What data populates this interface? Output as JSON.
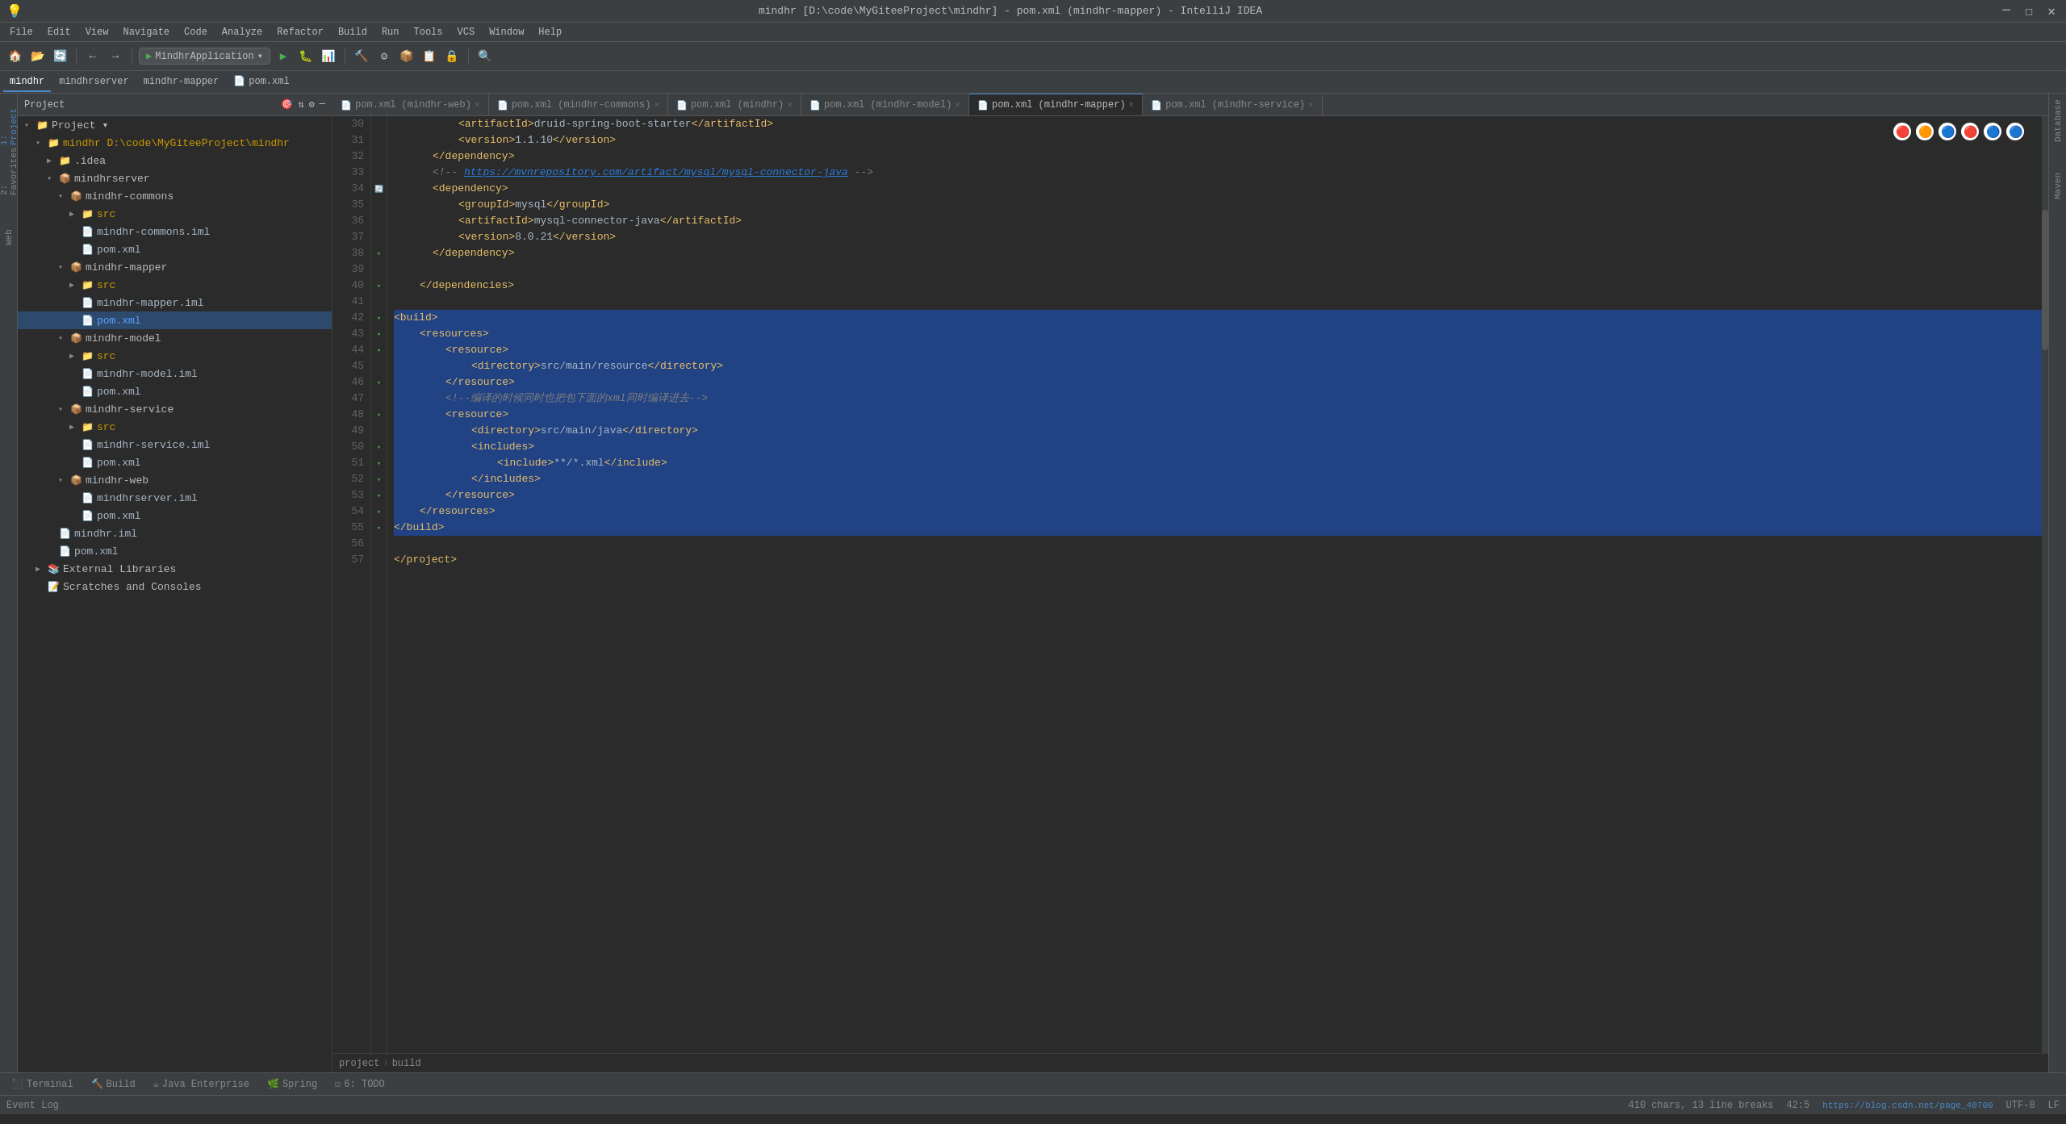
{
  "titleBar": {
    "title": "mindhr [D:\\code\\MyGiteeProject\\mindhr] - pom.xml (mindhr-mapper) - IntelliJ IDEA",
    "minimize": "─",
    "maximize": "☐",
    "close": "✕"
  },
  "menuBar": {
    "items": [
      "File",
      "Edit",
      "View",
      "Navigate",
      "Code",
      "Analyze",
      "Refactor",
      "Build",
      "Run",
      "Tools",
      "VCS",
      "Window",
      "Help"
    ]
  },
  "toolbar": {
    "runConfig": "MindhrApplication",
    "buttons": [
      "⬛",
      "📂",
      "🔄",
      "←",
      "→",
      "↩",
      "🔍",
      "▶",
      "🐛",
      "📊",
      "🔨",
      "🔧",
      "📦",
      "📋",
      "🔒",
      "⚙",
      "🔍"
    ]
  },
  "projectTabs": {
    "items": [
      "mindhr",
      "mindhrserver",
      "mindhr-mapper",
      "pom.xml"
    ]
  },
  "fileTree": {
    "header": "Project",
    "items": [
      {
        "id": "project-root",
        "label": "Project",
        "indent": 0,
        "type": "root",
        "expanded": true
      },
      {
        "id": "mindhr-root",
        "label": "mindhr D:\\code\\MyGiteeProject\\mindhr",
        "indent": 1,
        "type": "folder",
        "expanded": true
      },
      {
        "id": "idea",
        "label": ".idea",
        "indent": 2,
        "type": "folder",
        "expanded": false
      },
      {
        "id": "mindhrserver",
        "label": "mindhrserver",
        "indent": 2,
        "type": "module",
        "expanded": true
      },
      {
        "id": "mindhr-commons",
        "label": "mindhr-commons",
        "indent": 3,
        "type": "module",
        "expanded": true
      },
      {
        "id": "commons-src",
        "label": "src",
        "indent": 4,
        "type": "folder",
        "expanded": false
      },
      {
        "id": "commons-iml",
        "label": "mindhr-commons.iml",
        "indent": 4,
        "type": "iml"
      },
      {
        "id": "commons-pom",
        "label": "pom.xml",
        "indent": 4,
        "type": "xml"
      },
      {
        "id": "mindhr-mapper",
        "label": "mindhr-mapper",
        "indent": 3,
        "type": "module",
        "expanded": true
      },
      {
        "id": "mapper-src",
        "label": "src",
        "indent": 4,
        "type": "folder",
        "expanded": false
      },
      {
        "id": "mapper-iml",
        "label": "mindhr-mapper.iml",
        "indent": 4,
        "type": "iml"
      },
      {
        "id": "mapper-pom",
        "label": "pom.xml",
        "indent": 4,
        "type": "xml",
        "selected": true
      },
      {
        "id": "mindhr-model",
        "label": "mindhr-model",
        "indent": 3,
        "type": "module",
        "expanded": true
      },
      {
        "id": "model-src",
        "label": "src",
        "indent": 4,
        "type": "folder",
        "expanded": false
      },
      {
        "id": "model-iml",
        "label": "mindhr-model.iml",
        "indent": 4,
        "type": "iml"
      },
      {
        "id": "model-pom",
        "label": "pom.xml",
        "indent": 4,
        "type": "xml"
      },
      {
        "id": "mindhr-service",
        "label": "mindhr-service",
        "indent": 3,
        "type": "module",
        "expanded": true
      },
      {
        "id": "service-src",
        "label": "src",
        "indent": 4,
        "type": "folder",
        "expanded": false
      },
      {
        "id": "service-iml",
        "label": "mindhr-service.iml",
        "indent": 4,
        "type": "iml"
      },
      {
        "id": "service-pom",
        "label": "pom.xml",
        "indent": 4,
        "type": "xml"
      },
      {
        "id": "mindhr-web",
        "label": "mindhr-web",
        "indent": 3,
        "type": "module",
        "expanded": true
      },
      {
        "id": "web-iml",
        "label": "mindhrserver.iml",
        "indent": 4,
        "type": "iml"
      },
      {
        "id": "web-pom",
        "label": "pom.xml",
        "indent": 4,
        "type": "xml"
      },
      {
        "id": "mindhr-iml",
        "label": "mindhr.iml",
        "indent": 2,
        "type": "iml"
      },
      {
        "id": "root-pom",
        "label": "pom.xml",
        "indent": 2,
        "type": "xml"
      },
      {
        "id": "ext-libs",
        "label": "External Libraries",
        "indent": 1,
        "type": "extlib",
        "expanded": false
      },
      {
        "id": "scratches",
        "label": "Scratches and Consoles",
        "indent": 1,
        "type": "scratches"
      }
    ]
  },
  "editorTabs": [
    {
      "label": "pom.xml (mindhr-web)",
      "active": false,
      "closeable": true
    },
    {
      "label": "pom.xml (mindhr-commons)",
      "active": false,
      "closeable": true
    },
    {
      "label": "pom.xml (mindhr)",
      "active": false,
      "closeable": true
    },
    {
      "label": "pom.xml (mindhr-model)",
      "active": false,
      "closeable": true
    },
    {
      "label": "pom.xml (mindhr-mapper)",
      "active": true,
      "closeable": true
    },
    {
      "label": "pom.xml (mindhr-service)",
      "active": false,
      "closeable": true
    }
  ],
  "codeLines": [
    {
      "num": 30,
      "content": "        <artifactId>druid-spring-boot-starter</artifactId>",
      "selected": false
    },
    {
      "num": 31,
      "content": "        <version>1.1.10</version>",
      "selected": false
    },
    {
      "num": 32,
      "content": "    </dependency>",
      "selected": false
    },
    {
      "num": 33,
      "content": "    <!-- https://mvnrepository.com/artifact/mysql/mysql-connector-java -->",
      "selected": false
    },
    {
      "num": 34,
      "content": "    <dependency>",
      "selected": false
    },
    {
      "num": 35,
      "content": "        <groupId>mysql</groupId>",
      "selected": false
    },
    {
      "num": 36,
      "content": "        <artifactId>mysql-connector-java</artifactId>",
      "selected": false
    },
    {
      "num": 37,
      "content": "        <version>8.0.21</version>",
      "selected": false
    },
    {
      "num": 38,
      "content": "    </dependency>",
      "selected": false
    },
    {
      "num": 39,
      "content": "",
      "selected": false
    },
    {
      "num": 40,
      "content": "</dependencies>",
      "selected": false
    },
    {
      "num": 41,
      "content": "",
      "selected": false
    },
    {
      "num": 42,
      "content": "<build>",
      "selected": true,
      "cursorLine": true
    },
    {
      "num": 43,
      "content": "    <resources>",
      "selected": true
    },
    {
      "num": 44,
      "content": "        <resource>",
      "selected": true
    },
    {
      "num": 45,
      "content": "            <directory>src/main/resource</directory>",
      "selected": true
    },
    {
      "num": 46,
      "content": "        </resource>",
      "selected": true
    },
    {
      "num": 47,
      "content": "        <!-- 编译的时候同时也把包下面的xml同时编译进去-->",
      "selected": true
    },
    {
      "num": 48,
      "content": "        <resource>",
      "selected": true
    },
    {
      "num": 49,
      "content": "            <directory>src/main/java</directory>",
      "selected": true
    },
    {
      "num": 50,
      "content": "            <includes>",
      "selected": true
    },
    {
      "num": 51,
      "content": "                <include>**/*.xml</include>",
      "selected": true
    },
    {
      "num": 52,
      "content": "            </includes>",
      "selected": true
    },
    {
      "num": 53,
      "content": "        </resource>",
      "selected": true
    },
    {
      "num": 54,
      "content": "    </resources>",
      "selected": true
    },
    {
      "num": 55,
      "content": "</build>",
      "selected": true
    },
    {
      "num": 56,
      "content": "",
      "selected": false
    },
    {
      "num": 57,
      "content": "</project>",
      "selected": false
    }
  ],
  "breadcrumb": {
    "items": [
      "project",
      "build"
    ]
  },
  "statusBar": {
    "terminal": "Terminal",
    "build": "Build",
    "javaEnterprise": "Java Enterprise",
    "spring": "Spring",
    "todo": "6: TODO",
    "chars": "410 chars, 13 line breaks",
    "position": "42:5",
    "encoding": "UTF-8",
    "lineSeparator": "LF",
    "eventLog": "Event Log",
    "url": "https://blog.csdn.net/page_40700"
  },
  "rightSidebar": {
    "items": [
      "Database",
      "Maven"
    ]
  },
  "leftSidebar": {
    "items": [
      "1: Project",
      "2: Favorites",
      "Web"
    ]
  },
  "browserIcons": [
    "🔴",
    "🟠",
    "🔵",
    "🔴",
    "🔵",
    "🔵"
  ]
}
